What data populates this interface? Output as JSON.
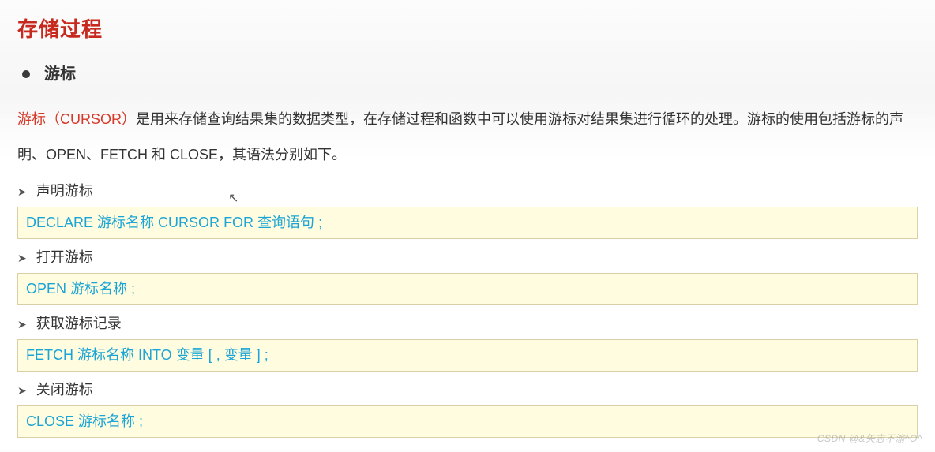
{
  "title": "存储过程",
  "heading": "游标",
  "intro_accent": "游标（CURSOR）",
  "intro_rest": "是用来存储查询结果集的数据类型，在存储过程和函数中可以使用游标对结果集进行循环的处理。游标的使用包括游标的声明、OPEN、FETCH 和 CLOSE，其语法分别如下。",
  "sections": [
    {
      "label": "声明游标",
      "code_parts": [
        "DECLARE ",
        "游标名称 ",
        "CURSOR ",
        "FOR ",
        "查询语句",
        " ;"
      ]
    },
    {
      "label": "打开游标",
      "code_parts": [
        "OPEN ",
        "游标名称",
        " ;"
      ]
    },
    {
      "label": "获取游标记录",
      "code_parts": [
        "FETCH ",
        "游标名称 ",
        "INTO ",
        "变量 [ , 变量 ]",
        " ;"
      ]
    },
    {
      "label": "关闭游标",
      "code_parts": [
        "CLOSE ",
        "游标名称",
        " ;"
      ]
    }
  ],
  "pointer_glyph": "↖",
  "watermark": "CSDN @&矢志不渝^O^"
}
